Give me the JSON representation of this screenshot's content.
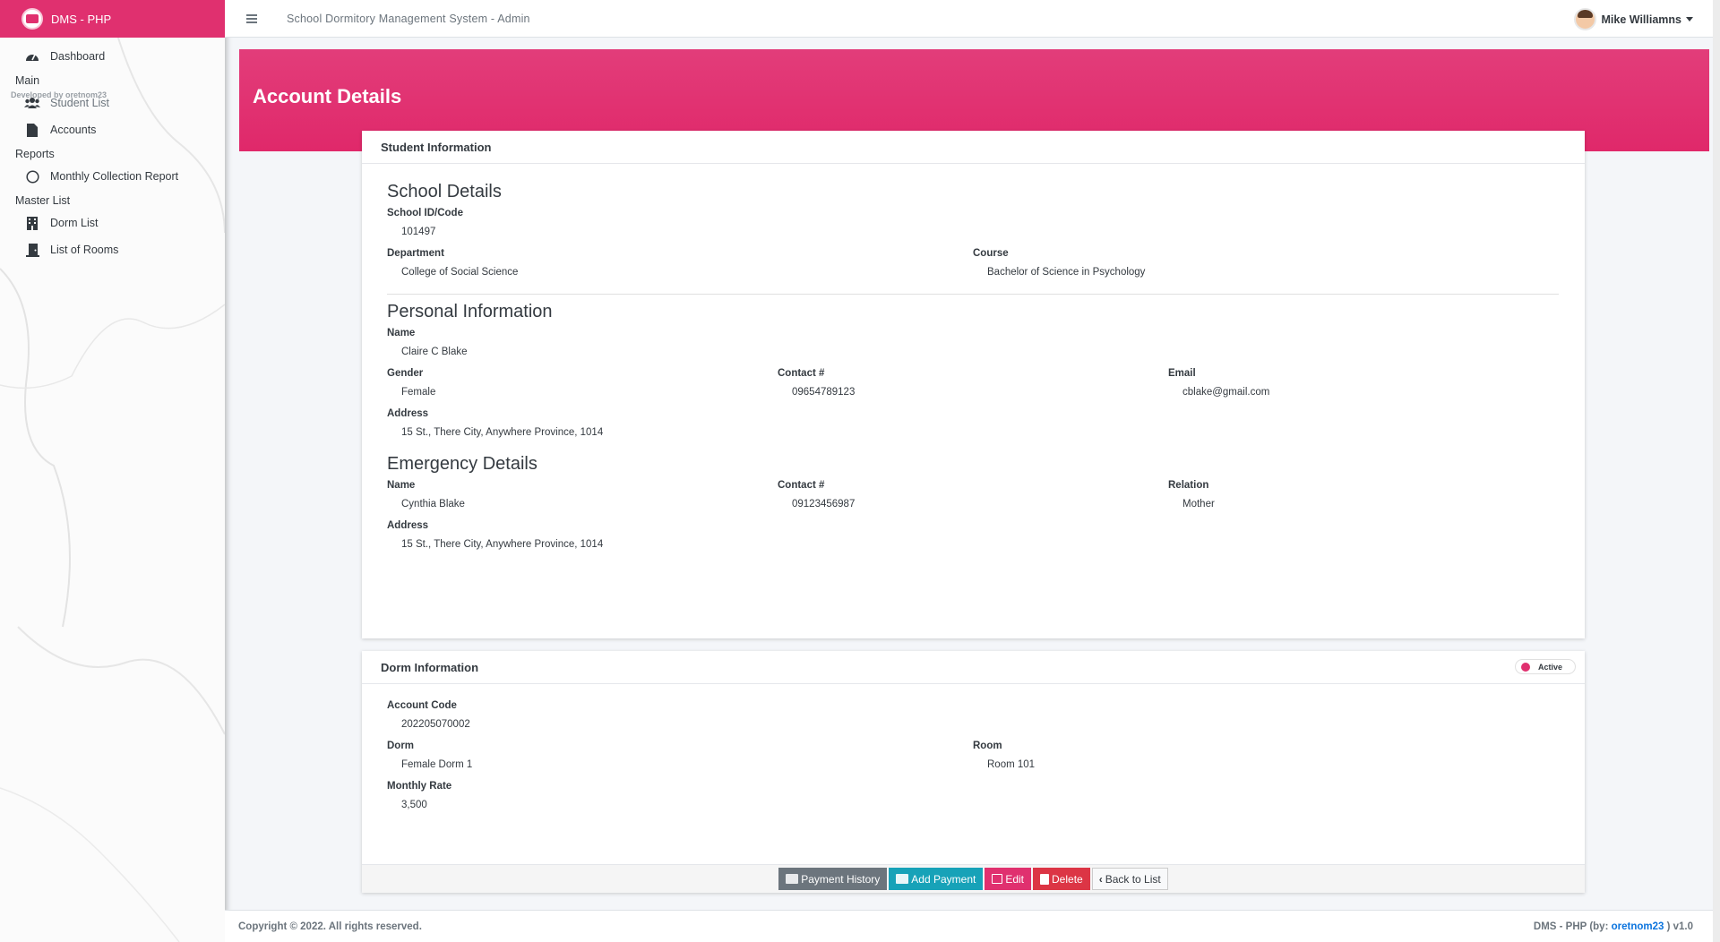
{
  "brand": {
    "name": "DMS - PHP"
  },
  "topbar": {
    "system_title": "School Dormitory Management System - Admin",
    "user_name": "Mike Williamns"
  },
  "sidebar": {
    "dashboard": "Dashboard",
    "header_main": "Main",
    "dev_credit": "Developed by oretnom23",
    "student_list": "Student List",
    "accounts": "Accounts",
    "header_reports": "Reports",
    "monthly_report": "Monthly Collection Report",
    "header_master": "Master List",
    "dorm_list": "Dorm List",
    "rooms_list": "List of Rooms"
  },
  "page": {
    "title": "Account Details"
  },
  "student_card": {
    "header": "Student Information",
    "school_title": "School Details",
    "school_id_label": "School ID/Code",
    "school_id": "101497",
    "department_label": "Department",
    "department": "College of Social Science",
    "course_label": "Course",
    "course": "Bachelor of Science in Psychology",
    "personal_title": "Personal Information",
    "name_label": "Name",
    "name": "Claire C Blake",
    "gender_label": "Gender",
    "gender": "Female",
    "contact_label": "Contact #",
    "contact": "09654789123",
    "email_label": "Email",
    "email": "cblake@gmail.com",
    "address_label": "Address",
    "address": "15 St., There City, Anywhere Province, 1014",
    "emergency_title": "Emergency Details",
    "em_name_label": "Name",
    "em_name": "Cynthia Blake",
    "em_contact_label": "Contact #",
    "em_contact": "09123456987",
    "em_relation_label": "Relation",
    "em_relation": "Mother",
    "em_address_label": "Address",
    "em_address": "15 St., There City, Anywhere Province, 1014"
  },
  "dorm_card": {
    "header": "Dorm Information",
    "status": "Active",
    "account_code_label": "Account Code",
    "account_code": "202205070002",
    "dorm_label": "Dorm",
    "dorm": "Female Dorm 1",
    "room_label": "Room",
    "room": "Room 101",
    "rate_label": "Monthly Rate",
    "rate": "3,500"
  },
  "actions": {
    "payment_history": "Payment History",
    "add_payment": "Add Payment",
    "edit": "Edit",
    "delete": "Delete",
    "back": "Back to List"
  },
  "footer": {
    "copyright": "Copyright © 2022. All rights reserved.",
    "credit_prefix": "DMS - PHP (by: ",
    "credit_author": "oretnom23",
    "credit_suffix": " ) v1.0"
  },
  "colors": {
    "accent": "#e0306f",
    "info": "#17a2b8",
    "secondary": "#6c757d",
    "danger": "#dc3545"
  }
}
